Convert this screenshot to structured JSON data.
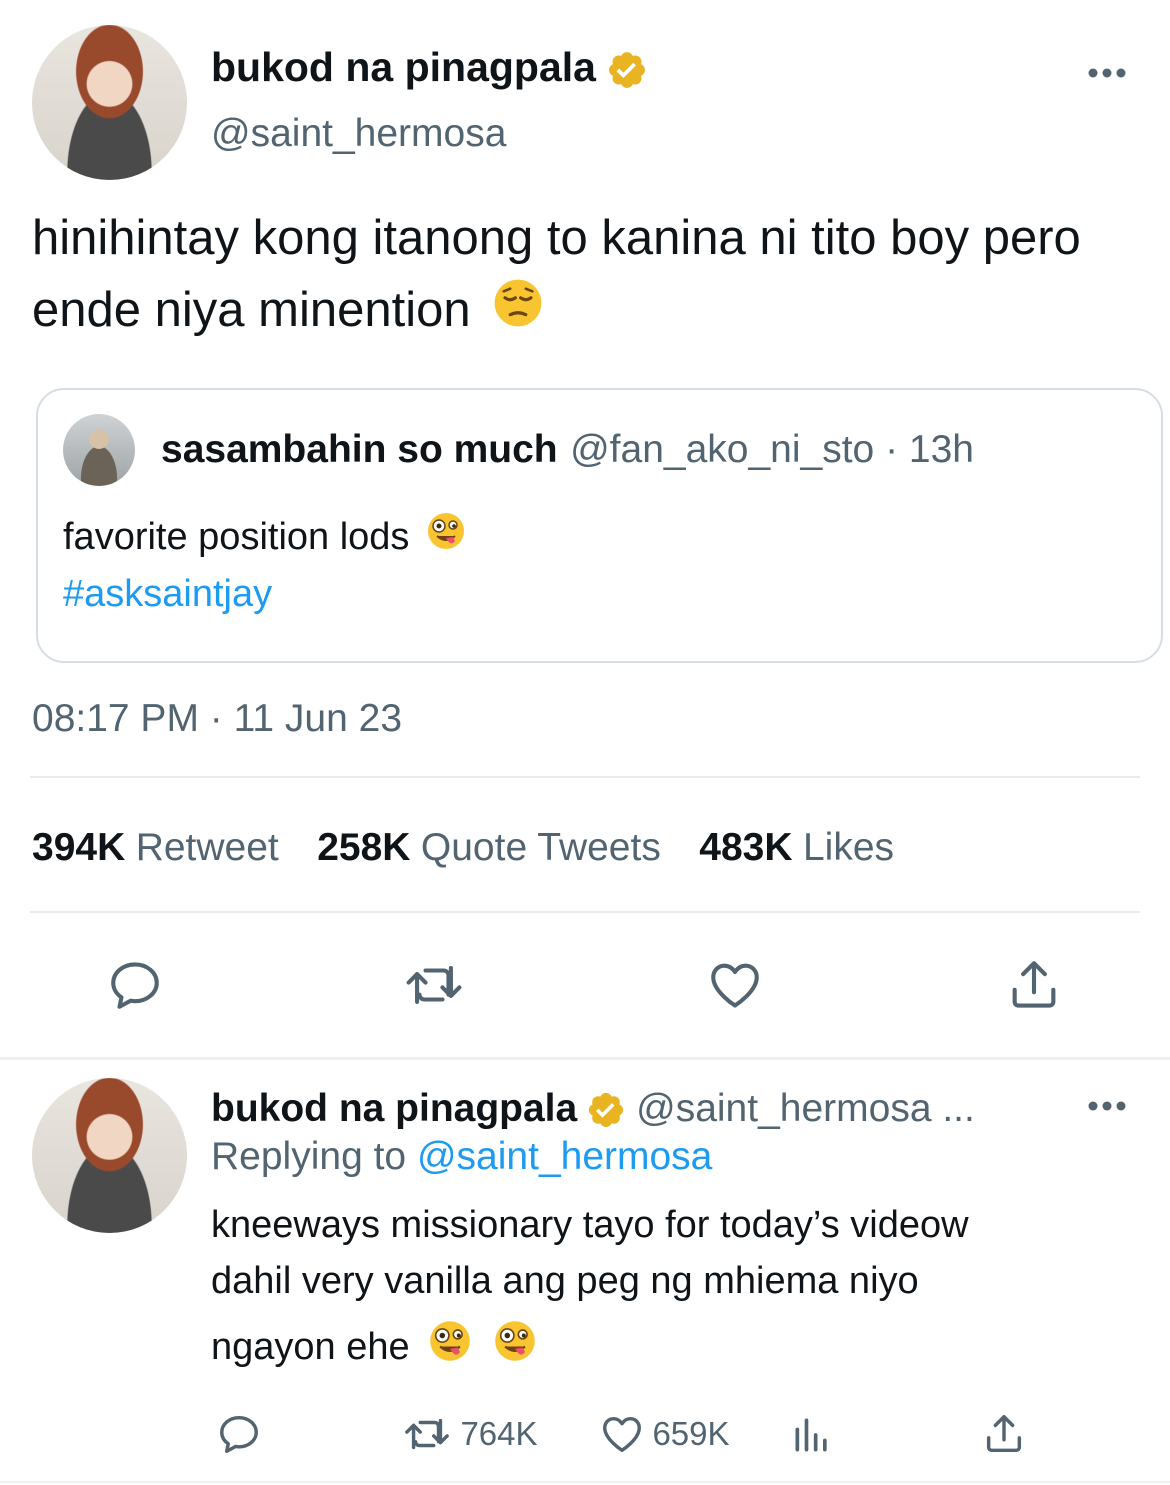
{
  "main_tweet": {
    "author_name": "bukod na pinagpala",
    "author_handle": "@saint_hermosa",
    "text": "hinihintay kong itanong to kanina ni tito boy pero ende niya minention",
    "timestamp": "08:17 PM · 11 Jun 23"
  },
  "quoted_tweet": {
    "author_name": "sasambahin so much",
    "author_handle": "@fan_ako_ni_sto · 13h",
    "text": "favorite position lods",
    "hashtag": "#asksaintjay"
  },
  "stats": {
    "retweets_count": "394K",
    "retweets_label": "Retweet",
    "quotes_count": "258K",
    "quotes_label": "Quote Tweets",
    "likes_count": "483K",
    "likes_label": "Likes"
  },
  "reply": {
    "author_name": "bukod na pinagpala",
    "author_handle": "@saint_hermosa ...",
    "replying_prefix": "Replying to",
    "replying_handle": "@saint_hermosa",
    "line1": "kneeways missionary tayo for today’s videow",
    "line2": "dahil very vanilla ang peg ng mhiema niyo",
    "line3": "ngayon ehe",
    "retweet_count": "764K",
    "like_count": "659K"
  },
  "icons": {
    "verified": "verified-badge-icon",
    "more": "more-icon",
    "reply": "reply-icon",
    "retweet": "retweet-icon",
    "like": "heart-icon",
    "share": "share-icon",
    "views": "views-icon"
  },
  "colors": {
    "link": "#1d9bf0",
    "secondary": "#536471",
    "verified": "#e8b422"
  }
}
